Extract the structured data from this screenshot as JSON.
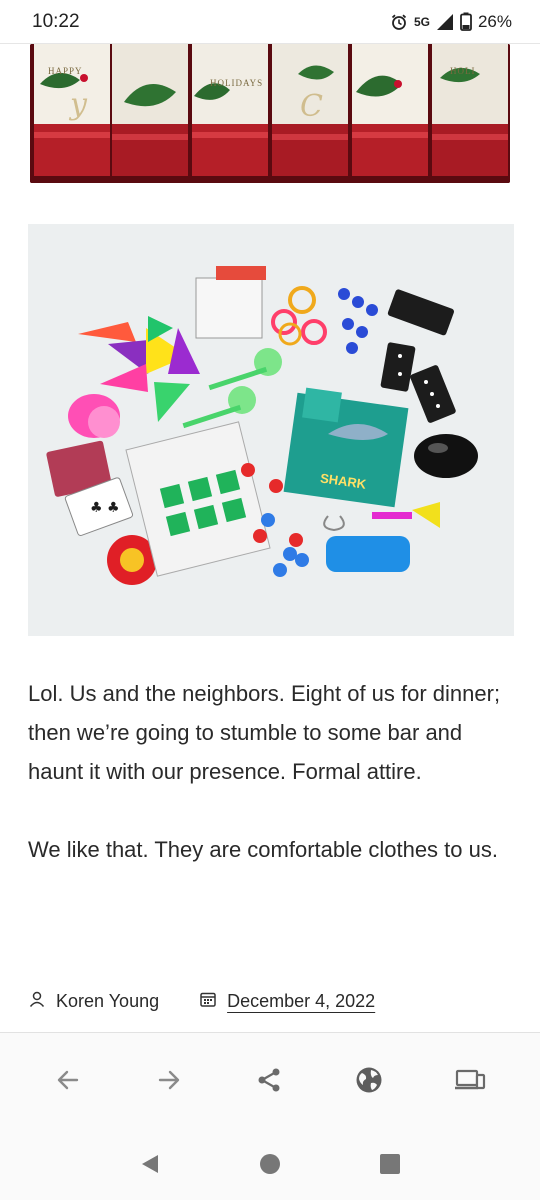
{
  "status_bar": {
    "time": "10:22",
    "network": "5G",
    "battery": "26%",
    "icons": [
      "alarm-icon",
      "signal-icon",
      "battery-icon"
    ]
  },
  "images": {
    "cracker_banner": "christmas-crackers-photo",
    "toys": "cracker-toys-photo",
    "lettering": [
      "Happy Holidays",
      "SHARK"
    ]
  },
  "post": {
    "paragraphs": [
      "Lol. Us and the neighbors. Eight of us for dinner; then we’re going to stumble to some bar and haunt it with our presence. Formal attire.",
      "We like that. They are comfortable clothes to us."
    ],
    "author": "Koren Young",
    "date": "December 4, 2022"
  },
  "browser_bar": {
    "buttons": [
      "back-icon",
      "forward-icon",
      "share-icon",
      "globe-icon",
      "devices-icon"
    ]
  },
  "android_nav": {
    "buttons": [
      "nav-back-icon",
      "nav-home-icon",
      "nav-recents-icon"
    ]
  },
  "colors": {
    "cracker_red": "#b51f28",
    "holly_green": "#2c6b2f",
    "text": "#2a2a2a",
    "icon_grey": "#777777"
  }
}
